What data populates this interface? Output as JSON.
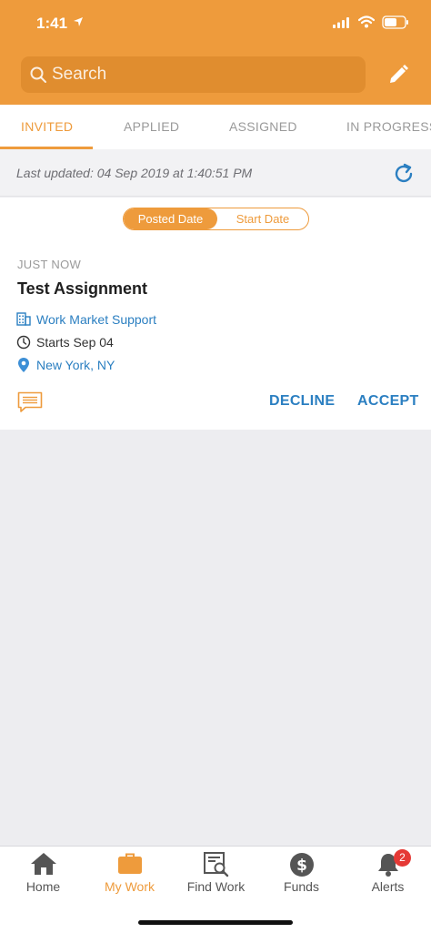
{
  "status_bar": {
    "time": "1:41"
  },
  "search": {
    "placeholder": "Search"
  },
  "tabs": [
    {
      "label": "INVITED",
      "active": true
    },
    {
      "label": "APPLIED",
      "active": false
    },
    {
      "label": "ASSIGNED",
      "active": false
    },
    {
      "label": "IN PROGRESS",
      "active": false
    }
  ],
  "last_updated": "Last updated: 04 Sep 2019 at 1:40:51 PM",
  "sort": {
    "posted_label": "Posted Date",
    "start_label": "Start Date",
    "selected": "Posted Date"
  },
  "assignment": {
    "timestamp": "JUST NOW",
    "title": "Test Assignment",
    "company": "Work Market Support",
    "starts": "Starts Sep 04",
    "location": "New York, NY",
    "decline_label": "DECLINE",
    "accept_label": "ACCEPT"
  },
  "bottom_nav": [
    {
      "label": "Home",
      "icon": "home-icon",
      "active": false
    },
    {
      "label": "My Work",
      "icon": "briefcase-icon",
      "active": true
    },
    {
      "label": "Find Work",
      "icon": "find-work-icon",
      "active": false
    },
    {
      "label": "Funds",
      "icon": "dollar-icon",
      "active": false
    },
    {
      "label": "Alerts",
      "icon": "bell-icon",
      "active": false,
      "badge": "2"
    }
  ],
  "colors": {
    "accent": "#ee9b3c",
    "link": "#2b7fc1",
    "badge": "#e53935"
  }
}
